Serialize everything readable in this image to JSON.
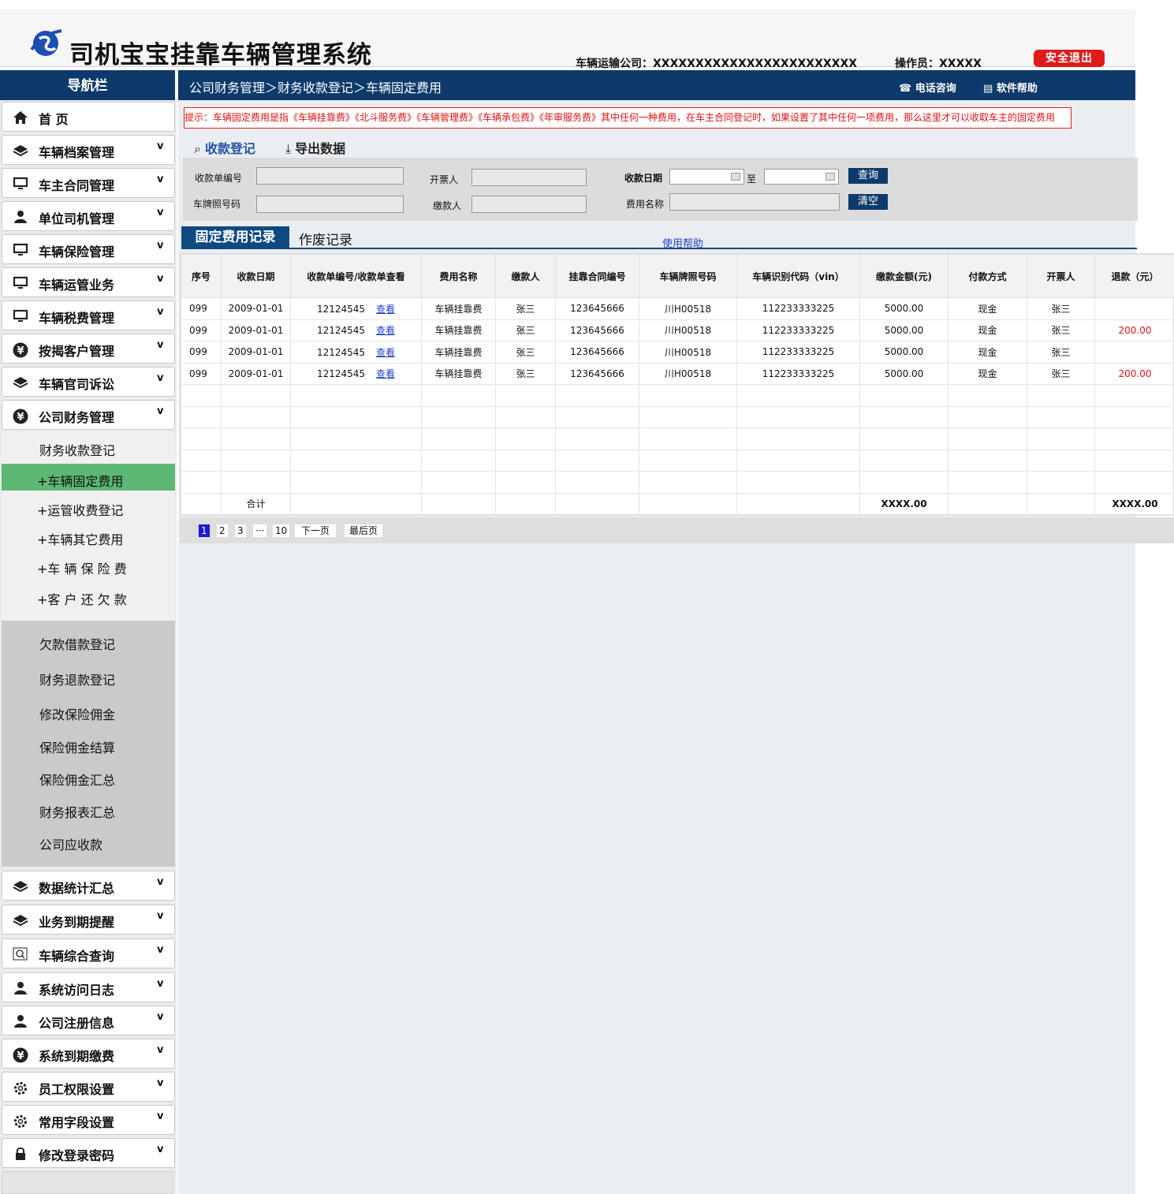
{
  "header": {
    "app_title": "司机宝宝挂靠车辆管理系统",
    "company": "车辆运输公司：XXXXXXXXXXXXXXXXXXXXXXXX",
    "operator": "操作员：XXXXX",
    "logout": "安全退出"
  },
  "nav_title": "导航栏",
  "sidebar": {
    "top_items": [
      {
        "label": "首    页",
        "icon": "home-icon"
      },
      {
        "label": "车辆档案管理",
        "icon": "layers-icon"
      },
      {
        "label": "车主合同管理",
        "icon": "monitor-icon"
      },
      {
        "label": "单位司机管理",
        "icon": "user-icon"
      },
      {
        "label": "车辆保险管理",
        "icon": "monitor-icon"
      },
      {
        "label": "车辆运管业务",
        "icon": "monitor-icon"
      },
      {
        "label": "车辆税费管理",
        "icon": "monitor-icon"
      },
      {
        "label": "按揭客户管理",
        "icon": "yen-icon"
      },
      {
        "label": "车辆官司诉讼",
        "icon": "layers-icon"
      },
      {
        "label": "公司财务管理",
        "icon": "yen-icon"
      }
    ],
    "sub_items": [
      "财务收款登记",
      "+车辆固定费用",
      "+运管收费登记",
      "+车辆其它费用",
      "+车 辆 保 险 费",
      "+客 户 还 欠 款"
    ],
    "sub_items_2": [
      "欠款借款登记",
      "财务退款登记",
      "修改保险佣金",
      "保险佣金结算",
      "保险佣金汇总",
      "财务报表汇总",
      "公司应收款"
    ],
    "bottom_items": [
      {
        "label": "数据统计汇总",
        "icon": "layers-icon"
      },
      {
        "label": "业务到期提醒",
        "icon": "layers-icon"
      },
      {
        "label": "车辆综合查询",
        "icon": "search-icon"
      },
      {
        "label": "系统访问日志",
        "icon": "user-icon"
      },
      {
        "label": "公司注册信息",
        "icon": "user-icon"
      },
      {
        "label": "系统到期缴费",
        "icon": "yen-icon"
      },
      {
        "label": "员工权限设置",
        "icon": "gear-icon"
      },
      {
        "label": "常用字段设置",
        "icon": "gear-icon"
      },
      {
        "label": "修改登录密码",
        "icon": "lock-icon"
      }
    ]
  },
  "breadcrumb": "公司财务管理＞财务收款登记＞车辆固定费用",
  "top_links": {
    "phone": "电话咨询",
    "help": "软件帮助"
  },
  "tip": "提示：车辆固定费用是指《车辆挂靠费》《北斗服务费》《车辆管理费》《车辆承包费》《年审服务费》其中任何一种费用，在车主合同登记时，如果设置了其中任何一项费用，那么这里才可以收取车主的固定费用",
  "actions": {
    "register": "收款登记",
    "export": "导出数据"
  },
  "search": {
    "receipt_no": "收款单编号",
    "invoicer": "开票人",
    "date": "收款日期",
    "to": "至",
    "query": "查询",
    "plate": "车牌照号码",
    "payer": "缴款人",
    "fee_name": "费用名称",
    "clear": "清空"
  },
  "tabs": {
    "active": "固定费用记录",
    "other": "作废记录",
    "help": "使用帮助"
  },
  "table": {
    "headers": [
      "序号",
      "收款日期",
      "收款单编号/收款单查看",
      "费用名称",
      "缴款人",
      "挂靠合同编号",
      "车辆牌照号码",
      "车辆识别代码（vin）",
      "缴款金额(元)",
      "付款方式",
      "开票人",
      "退款（元）"
    ],
    "rows": [
      {
        "no": "099",
        "date": "2009-01-01",
        "receipt": "12124545",
        "view": "查看",
        "fee": "车辆挂靠费",
        "payer": "张三",
        "contract": "123645666",
        "plate": "川H00518",
        "vin": "112233333225",
        "amount": "5000.00",
        "method": "现金",
        "invoicer": "张三",
        "refund": ""
      },
      {
        "no": "099",
        "date": "2009-01-01",
        "receipt": "12124545",
        "view": "查看",
        "fee": "车辆挂靠费",
        "payer": "张三",
        "contract": "123645666",
        "plate": "川H00518",
        "vin": "112233333225",
        "amount": "5000.00",
        "method": "现金",
        "invoicer": "张三",
        "refund": "200.00"
      },
      {
        "no": "099",
        "date": "2009-01-01",
        "receipt": "12124545",
        "view": "查看",
        "fee": "车辆挂靠费",
        "payer": "张三",
        "contract": "123645666",
        "plate": "川H00518",
        "vin": "112233333225",
        "amount": "5000.00",
        "method": "现金",
        "invoicer": "张三",
        "refund": ""
      },
      {
        "no": "099",
        "date": "2009-01-01",
        "receipt": "12124545",
        "view": "查看",
        "fee": "车辆挂靠费",
        "payer": "张三",
        "contract": "123645666",
        "plate": "川H00518",
        "vin": "112233333225",
        "amount": "5000.00",
        "method": "现金",
        "invoicer": "张三",
        "refund": "200.00"
      }
    ],
    "total_label": "合计",
    "total_amount": "XXXX.00",
    "total_refund": "XXXX.00"
  },
  "pager": {
    "pages": [
      "1",
      "2",
      "3",
      "···",
      "10"
    ],
    "next": "下一页",
    "last": "最后页"
  },
  "colors": {
    "navy": "#0e3a6b",
    "active_green": "#5cb874",
    "refund_red": "#e0121e",
    "logout_red": "#e01b1b"
  }
}
